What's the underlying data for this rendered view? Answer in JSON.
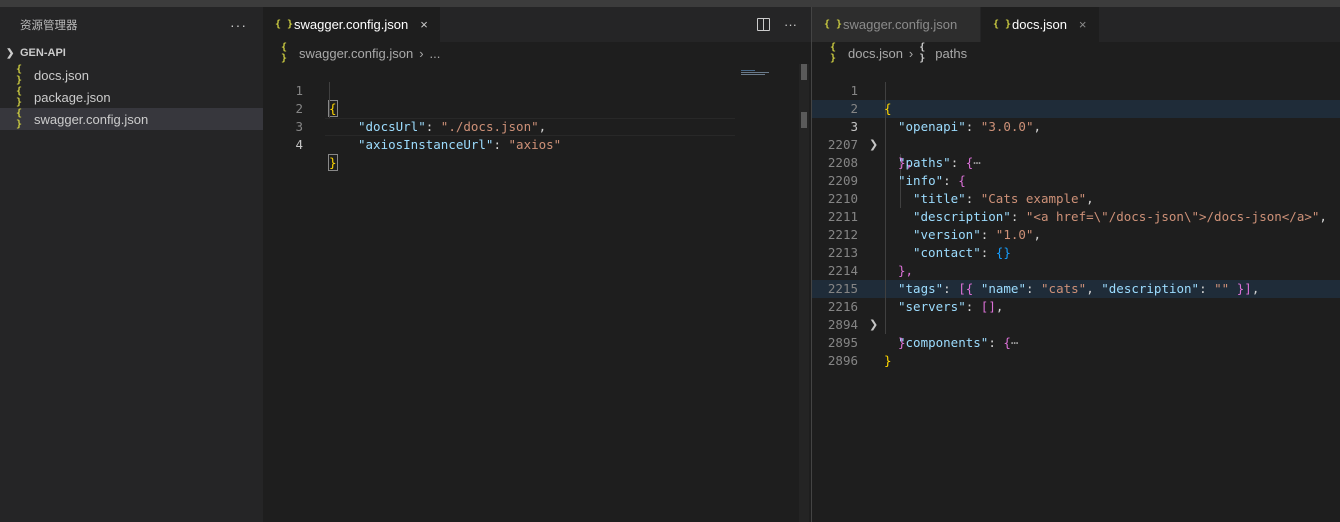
{
  "sidebar": {
    "title": "资源管理器",
    "more": "···",
    "folder": "GEN-API",
    "files": [
      {
        "name": "docs.json",
        "icon": "{ }"
      },
      {
        "name": "package.json",
        "icon": "{ }"
      },
      {
        "name": "swagger.config.json",
        "icon": "{ }"
      }
    ]
  },
  "left_editor": {
    "tab": {
      "title": "swagger.config.json",
      "icon": "{ }",
      "close": "×"
    },
    "actions": {
      "more": "···"
    },
    "breadcrumb": {
      "icon": "{ }",
      "file": "swagger.config.json",
      "sep": "›",
      "rest": "..."
    },
    "lines": [
      {
        "n": "1",
        "brace_open": "{"
      },
      {
        "n": "2",
        "key": "\"docsUrl\"",
        "colon": ": ",
        "value": "\"./docs.json\"",
        "comma": ","
      },
      {
        "n": "3",
        "key": "\"axiosInstanceUrl\"",
        "colon": ": ",
        "value": "\"axios\""
      },
      {
        "n": "4",
        "brace_close": "}"
      }
    ]
  },
  "right_editor": {
    "tabs": [
      {
        "title": "swagger.config.json",
        "icon": "{ }"
      },
      {
        "title": "docs.json",
        "icon": "{ }",
        "close": "×"
      }
    ],
    "breadcrumb": {
      "icon": "{ }",
      "file": "docs.json",
      "sep": "›",
      "icon2": "{ }",
      "rest": "paths"
    },
    "line_numbers": [
      "1",
      "2",
      "3",
      "2207",
      "2208",
      "2209",
      "2210",
      "2211",
      "2212",
      "2213",
      "2214",
      "2215",
      "2216",
      "2894",
      "2895",
      "2896"
    ],
    "code": {
      "l1": "{",
      "l2_key": "\"openapi\"",
      "l2_val": "\"3.0.0\"",
      "l3_key": "\"paths\"",
      "l3_brace": "{",
      "l3_dots": "⋯",
      "l4": "},",
      "l5_key": "\"info\"",
      "l5_brace": "{",
      "l6_key": "\"title\"",
      "l6_val": "\"Cats example\"",
      "l7_key": "\"description\"",
      "l7_val": "\"<a href=\\\"/docs-json\\\">/docs-json</a>\"",
      "l8_key": "\"version\"",
      "l8_val": "\"1.0\"",
      "l9_key": "\"contact\"",
      "l9_val": "{}",
      "l10": "},",
      "l11_key": "\"tags\"",
      "l11_open": "[{",
      "l11_k1": "\"name\"",
      "l11_v1": "\"cats\"",
      "l11_k2": "\"description\"",
      "l11_v2": "\"\"",
      "l11_close": "}]",
      "l12_key": "\"servers\"",
      "l12_val": "[]",
      "l13_key": "\"components\"",
      "l13_brace": "{",
      "l13_dots": "⋯",
      "l14": "}",
      "l15": "}"
    },
    "fold_icon": "chevron-right-icon"
  }
}
